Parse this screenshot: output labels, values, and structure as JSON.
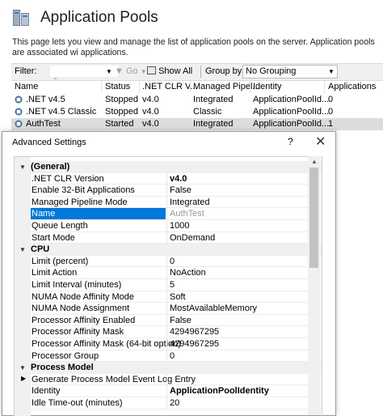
{
  "header": {
    "title": "Application Pools",
    "description": "This page lets you view and manage the list of application pools on the server. Application pools are associated wi applications."
  },
  "toolbar": {
    "filter_label": "Filter:",
    "go_label": "Go",
    "show_all_label": "Show All",
    "group_by_label": "Group by:",
    "group_by_value": "No Grouping"
  },
  "grid": {
    "columns": [
      "Name",
      "Status",
      ".NET CLR V...",
      "Managed Pipel...",
      "Identity",
      "Applications"
    ],
    "rows": [
      {
        "name": ".NET v4.5",
        "status": "Stopped",
        "clr": "v4.0",
        "pipeline": "Integrated",
        "identity": "ApplicationPoolId...",
        "apps": "0"
      },
      {
        "name": ".NET v4.5 Classic",
        "status": "Stopped",
        "clr": "v4.0",
        "pipeline": "Classic",
        "identity": "ApplicationPoolId...",
        "apps": "0"
      },
      {
        "name": "AuthTest",
        "status": "Started",
        "clr": "v4.0",
        "pipeline": "Integrated",
        "identity": "ApplicationPoolId...",
        "apps": "1"
      }
    ]
  },
  "dialog": {
    "title": "Advanced Settings",
    "help_glyph": "?",
    "close_glyph": "✕",
    "categories": {
      "general": "(General)",
      "cpu": "CPU",
      "process_model": "Process Model"
    },
    "general": [
      {
        "name": ".NET CLR Version",
        "value": "v4.0"
      },
      {
        "name": "Enable 32-Bit Applications",
        "value": "False"
      },
      {
        "name": "Managed Pipeline Mode",
        "value": "Integrated"
      },
      {
        "name": "Name",
        "value": "AuthTest"
      },
      {
        "name": "Queue Length",
        "value": "1000"
      },
      {
        "name": "Start Mode",
        "value": "OnDemand"
      }
    ],
    "cpu": [
      {
        "name": "Limit (percent)",
        "value": "0"
      },
      {
        "name": "Limit Action",
        "value": "NoAction"
      },
      {
        "name": "Limit Interval (minutes)",
        "value": "5"
      },
      {
        "name": "NUMA Node Affinity Mode",
        "value": "Soft"
      },
      {
        "name": "NUMA Node Assignment",
        "value": "MostAvailableMemory"
      },
      {
        "name": "Processor Affinity Enabled",
        "value": "False"
      },
      {
        "name": "Processor Affinity Mask",
        "value": "4294967295"
      },
      {
        "name": "Processor Affinity Mask (64-bit option)",
        "value": "4294967295"
      },
      {
        "name": "Processor Group",
        "value": "0"
      }
    ],
    "process_model": [
      {
        "name": "Generate Process Model Event Log Entry",
        "value": ""
      },
      {
        "name": "Identity",
        "value": "ApplicationPoolIdentity"
      },
      {
        "name": "Idle Time-out (minutes)",
        "value": "20"
      }
    ]
  },
  "colors": {
    "selection": "#0078d7",
    "selected_row": "#dcdcdc",
    "category_bg": "#f0f0f0"
  },
  "icons": [
    "app-pools-icon",
    "filter-dropdown-icon",
    "go-icon",
    "show-all-icon",
    "sort-indicator-icon",
    "app-pool-icon",
    "help-icon",
    "close-icon",
    "collapse-icon",
    "expand-icon",
    "scroll-up-icon"
  ]
}
